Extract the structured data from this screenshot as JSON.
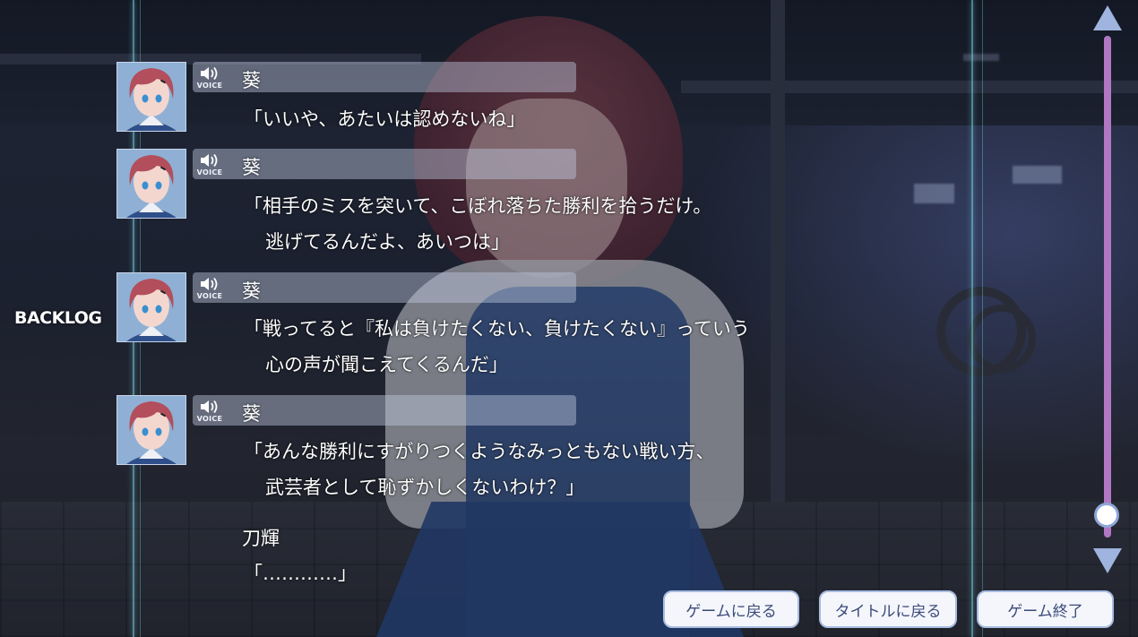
{
  "screen": {
    "label": "BACKLOG"
  },
  "voice": {
    "label": "VOICE",
    "icon": "speaker-icon"
  },
  "backlog": {
    "entries": [
      {
        "speaker": "葵",
        "has_voice": true,
        "lines": [
          "「いいや、あたいは認めないね」"
        ]
      },
      {
        "speaker": "葵",
        "has_voice": true,
        "lines": [
          "「相手のミスを突いて、こぼれ落ちた勝利を拾うだけ。",
          "逃げてるんだよ、あいつは」"
        ]
      },
      {
        "speaker": "葵",
        "has_voice": true,
        "lines": [
          "「戦ってると『私は負けたくない、負けたくない』っていう",
          "心の声が聞こえてくるんだ」"
        ]
      },
      {
        "speaker": "葵",
        "has_voice": true,
        "lines": [
          "「あんな勝利にすがりつくようなみっともない戦い方、",
          "武芸者として恥ずかしくないわけ？」"
        ]
      },
      {
        "speaker": "刀輝",
        "has_voice": false,
        "lines": [
          "「…………」"
        ]
      }
    ]
  },
  "scrollbar": {
    "position": 0.98
  },
  "buttons": {
    "return_game": "ゲームに戻る",
    "return_title": "タイトルに戻る",
    "quit_game": "ゲーム終了"
  },
  "colors": {
    "button_text": "#3b4a7a",
    "button_border": "#a9bce0",
    "scroll_track": "#b277c2",
    "scroll_arrow": "#9fb4de",
    "accent_line": "#78dceb"
  }
}
